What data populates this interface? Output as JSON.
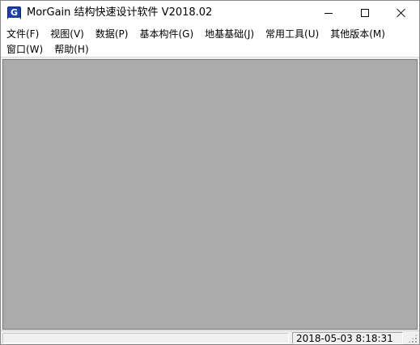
{
  "window": {
    "title": "MorGain 结构快速设计软件 V2018.02",
    "icon": "morgain-app-icon",
    "icon_letter": "G",
    "controls": [
      "minimize-icon",
      "maximize-icon",
      "close-icon"
    ]
  },
  "menu": {
    "items": [
      {
        "label": "文件(F)"
      },
      {
        "label": "视图(V)"
      },
      {
        "label": "数据(P)"
      },
      {
        "label": "基本构件(G)"
      },
      {
        "label": "地基基础(J)"
      },
      {
        "label": "常用工具(U)"
      },
      {
        "label": "其他版本(M)"
      },
      {
        "label": "窗口(W)"
      },
      {
        "label": "帮助(H)"
      }
    ]
  },
  "client": {
    "background": "#ababab"
  },
  "statusbar": {
    "message": "",
    "datetime": "2018-05-03 8:18:31"
  }
}
